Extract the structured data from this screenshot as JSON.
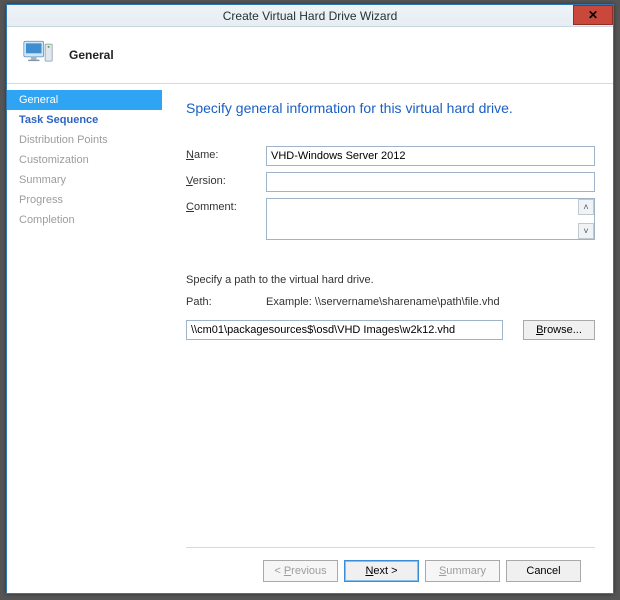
{
  "window": {
    "title": "Create Virtual Hard Drive Wizard",
    "close_glyph": "✕"
  },
  "header": {
    "icon": "computer-icon",
    "title": "General"
  },
  "sidebar": {
    "steps": [
      {
        "label": "General",
        "state": "current"
      },
      {
        "label": "Task Sequence",
        "state": "todo"
      },
      {
        "label": "Distribution Points",
        "state": "disabled"
      },
      {
        "label": "Customization",
        "state": "disabled"
      },
      {
        "label": "Summary",
        "state": "disabled"
      },
      {
        "label": "Progress",
        "state": "disabled"
      },
      {
        "label": "Completion",
        "state": "disabled"
      }
    ]
  },
  "main": {
    "heading": "Specify general information for this virtual hard drive.",
    "name_label": "Name:",
    "name_value": "VHD-Windows Server 2012",
    "version_label": "Version:",
    "version_value": "",
    "comment_label": "Comment:",
    "comment_value": "",
    "path_section_text": "Specify a path to the virtual hard drive.",
    "path_label": "Path:",
    "example_text": "Example: \\\\servername\\sharename\\path\\file.vhd",
    "path_value": "\\\\cm01\\packagesources$\\osd\\VHD Images\\w2k12.vhd",
    "browse_label": "Browse...",
    "browse_hotkey": "B"
  },
  "footer": {
    "previous_label": "< Previous",
    "previous_hotkey": "P",
    "next_label": "Next >",
    "next_hotkey": "N",
    "summary_label": "Summary",
    "summary_hotkey": "S",
    "cancel_label": "Cancel"
  }
}
